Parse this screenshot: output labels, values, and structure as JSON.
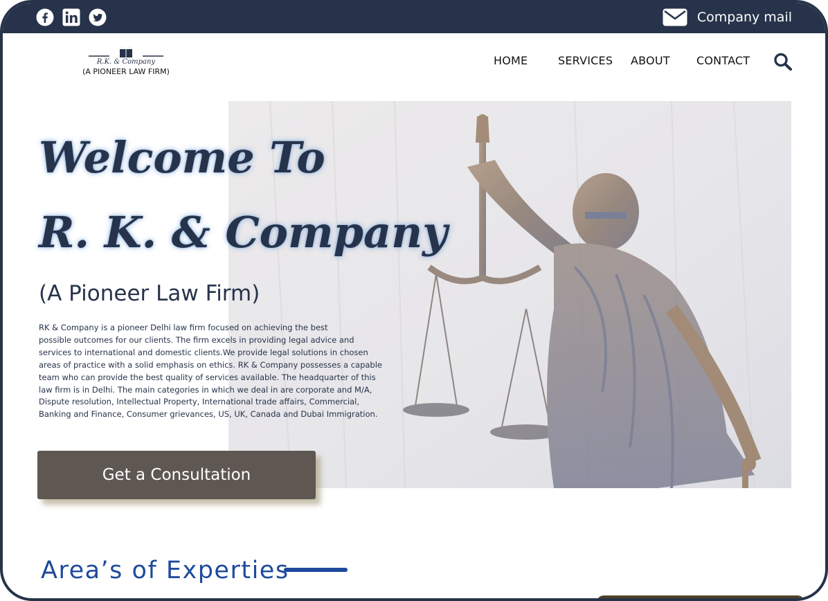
{
  "topbar": {
    "social": [
      "facebook-icon",
      "linkedin-icon",
      "twitter-icon"
    ],
    "mail_icon": "envelope-icon",
    "mail_label": "Company mail"
  },
  "logo": {
    "name": "R.K. & Company",
    "subtitle": "(A PIONEER LAW FIRM)"
  },
  "nav": {
    "items": [
      "HOME",
      "SERVICES",
      "ABOUT",
      "CONTACT"
    ],
    "search_icon": "search-icon"
  },
  "hero": {
    "title_line1": "Welcome To",
    "title_line2": "R. K. & Company",
    "tagline": "(A Pioneer Law Firm)",
    "description_lines": [
      "RK & Company is a pioneer Delhi law firm focused on achieving the best",
      "possible outcomes for our clients. The firm excels in providing legal advice and",
      "services to international and domestic clients.We provide legal solutions in chosen",
      "areas of practice with a solid emphasis on ethics. RK & Company possesses a capable",
      "team who can provide the best quality of services available. The headquarter of this",
      "law firm is in Delhi. The main categories in which we deal in are corporate and M/A,",
      "Dispute resolution, Intellectual Property, International trade affairs, Commercial,",
      "Banking and Finance, Consumer grievances, US, UK, Canada and Dubai Immigration."
    ],
    "cta_label": "Get a Consultation",
    "image": "lady-justice-statue"
  },
  "expertise": {
    "heading": "Area’s of Experties"
  },
  "colors": {
    "navy": "#26334a",
    "accent_blue": "#1e4a9c",
    "button": "#5f5752",
    "bronze": "#8a6a47"
  }
}
